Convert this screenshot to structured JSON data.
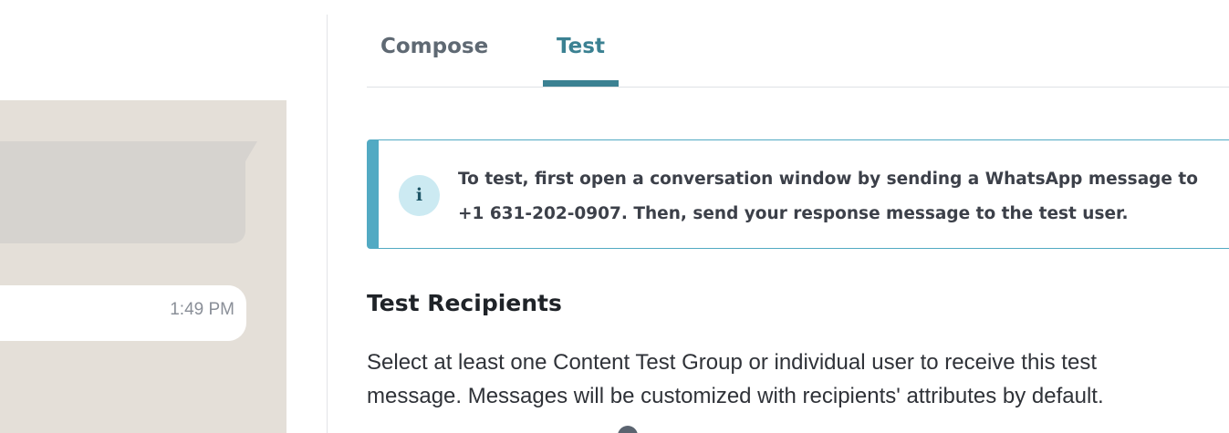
{
  "preview": {
    "message_time": "1:49 PM"
  },
  "tabs": [
    {
      "label": "Compose",
      "active": false
    },
    {
      "label": "Test",
      "active": true
    }
  ],
  "colors": {
    "accent": "#3b8192",
    "banner_border": "#52aac3",
    "preview_bg": "#e4dfd8"
  },
  "banner": {
    "icon": "info-icon",
    "icon_glyph": "i",
    "line1": "To test, first open a conversation window by sending a WhatsApp message to",
    "line2": "+1 631-202-0907. Then, send your response message to the test user."
  },
  "recipients": {
    "title": "Test Recipients",
    "description_line1": "Select at least one Content Test Group or individual user to receive this test",
    "description_line2": "message. Messages will be customized with recipients' attributes by default."
  }
}
